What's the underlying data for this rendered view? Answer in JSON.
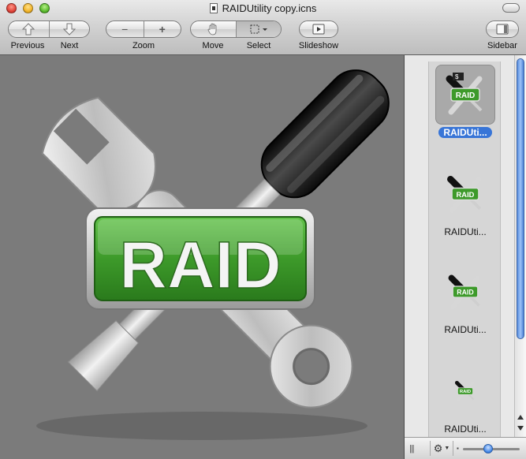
{
  "window": {
    "title": "RAIDUtility copy.icns"
  },
  "toolbar": {
    "previous_label": "Previous",
    "next_label": "Next",
    "zoom_label": "Zoom",
    "move_label": "Move",
    "select_label": "Select",
    "slideshow_label": "Slideshow",
    "sidebar_label": "Sidebar"
  },
  "icon": {
    "badge_text": "RAID"
  },
  "sidebar": {
    "thumbnails": [
      {
        "name": "RAIDUti...",
        "selected": true
      },
      {
        "name": "RAIDUti...",
        "selected": false
      },
      {
        "name": "RAIDUti...",
        "selected": false
      },
      {
        "name": "RAIDUti...",
        "selected": false
      }
    ],
    "thumb_badge": "RAID"
  },
  "colors": {
    "badge_green": "#3d9a2a",
    "selection_blue": "#3875d7"
  }
}
